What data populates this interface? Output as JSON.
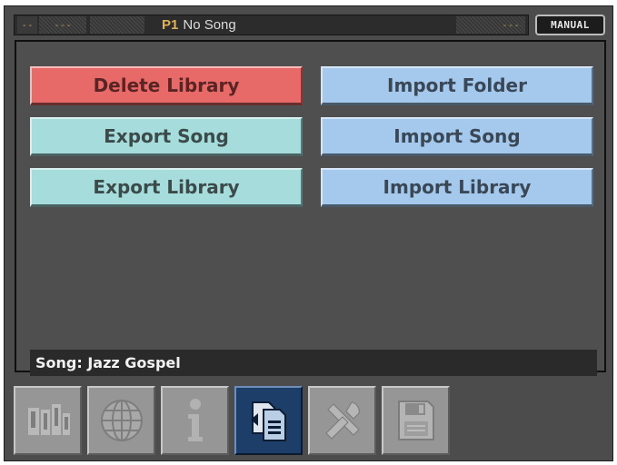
{
  "status_bar": {
    "cell_a": "--",
    "cell_b": "---",
    "cell_c": "",
    "program": "P1",
    "song_title": "No Song",
    "cell_d": "---",
    "mode_badge": "MANUAL"
  },
  "buttons": {
    "delete_library": "Delete Library",
    "import_folder": "Import Folder",
    "export_song": "Export Song",
    "import_song": "Import Song",
    "export_library": "Export Library",
    "import_library": "Import Library"
  },
  "song_line": {
    "label": "Song:",
    "value": "Jazz Gospel"
  },
  "tabs": [
    {
      "icon": "library-books-icon",
      "active": false
    },
    {
      "icon": "globe-icon",
      "active": false
    },
    {
      "icon": "info-icon",
      "active": false
    },
    {
      "icon": "file-transfer-icon",
      "active": true
    },
    {
      "icon": "tools-icon",
      "active": false
    },
    {
      "icon": "floppy-disk-icon",
      "active": false
    }
  ],
  "colors": {
    "delete": "#e86a68",
    "export": "#a6dcdc",
    "import": "#a4c9ec",
    "active_tab": "#1d3e68",
    "program_accent": "#e0b255"
  }
}
